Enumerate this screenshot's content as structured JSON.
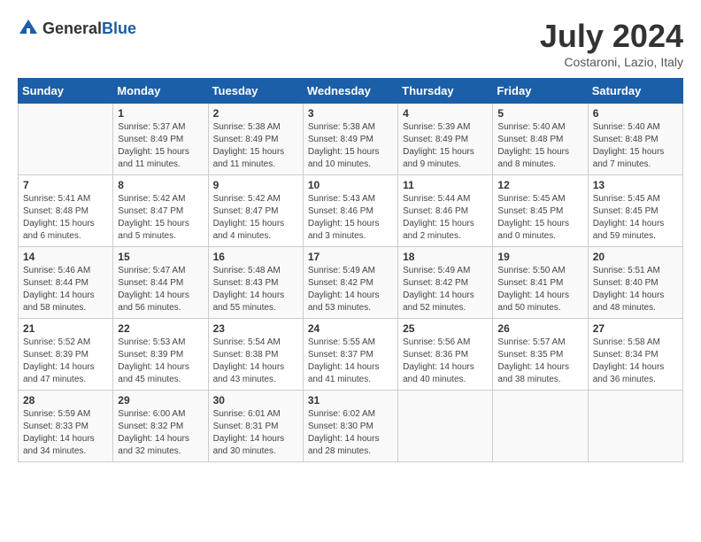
{
  "header": {
    "logo_general": "General",
    "logo_blue": "Blue",
    "month_year": "July 2024",
    "location": "Costaroni, Lazio, Italy"
  },
  "weekdays": [
    "Sunday",
    "Monday",
    "Tuesday",
    "Wednesday",
    "Thursday",
    "Friday",
    "Saturday"
  ],
  "weeks": [
    [
      {
        "day": "",
        "info": ""
      },
      {
        "day": "1",
        "info": "Sunrise: 5:37 AM\nSunset: 8:49 PM\nDaylight: 15 hours\nand 11 minutes."
      },
      {
        "day": "2",
        "info": "Sunrise: 5:38 AM\nSunset: 8:49 PM\nDaylight: 15 hours\nand 11 minutes."
      },
      {
        "day": "3",
        "info": "Sunrise: 5:38 AM\nSunset: 8:49 PM\nDaylight: 15 hours\nand 10 minutes."
      },
      {
        "day": "4",
        "info": "Sunrise: 5:39 AM\nSunset: 8:49 PM\nDaylight: 15 hours\nand 9 minutes."
      },
      {
        "day": "5",
        "info": "Sunrise: 5:40 AM\nSunset: 8:48 PM\nDaylight: 15 hours\nand 8 minutes."
      },
      {
        "day": "6",
        "info": "Sunrise: 5:40 AM\nSunset: 8:48 PM\nDaylight: 15 hours\nand 7 minutes."
      }
    ],
    [
      {
        "day": "7",
        "info": "Sunrise: 5:41 AM\nSunset: 8:48 PM\nDaylight: 15 hours\nand 6 minutes."
      },
      {
        "day": "8",
        "info": "Sunrise: 5:42 AM\nSunset: 8:47 PM\nDaylight: 15 hours\nand 5 minutes."
      },
      {
        "day": "9",
        "info": "Sunrise: 5:42 AM\nSunset: 8:47 PM\nDaylight: 15 hours\nand 4 minutes."
      },
      {
        "day": "10",
        "info": "Sunrise: 5:43 AM\nSunset: 8:46 PM\nDaylight: 15 hours\nand 3 minutes."
      },
      {
        "day": "11",
        "info": "Sunrise: 5:44 AM\nSunset: 8:46 PM\nDaylight: 15 hours\nand 2 minutes."
      },
      {
        "day": "12",
        "info": "Sunrise: 5:45 AM\nSunset: 8:45 PM\nDaylight: 15 hours\nand 0 minutes."
      },
      {
        "day": "13",
        "info": "Sunrise: 5:45 AM\nSunset: 8:45 PM\nDaylight: 14 hours\nand 59 minutes."
      }
    ],
    [
      {
        "day": "14",
        "info": "Sunrise: 5:46 AM\nSunset: 8:44 PM\nDaylight: 14 hours\nand 58 minutes."
      },
      {
        "day": "15",
        "info": "Sunrise: 5:47 AM\nSunset: 8:44 PM\nDaylight: 14 hours\nand 56 minutes."
      },
      {
        "day": "16",
        "info": "Sunrise: 5:48 AM\nSunset: 8:43 PM\nDaylight: 14 hours\nand 55 minutes."
      },
      {
        "day": "17",
        "info": "Sunrise: 5:49 AM\nSunset: 8:42 PM\nDaylight: 14 hours\nand 53 minutes."
      },
      {
        "day": "18",
        "info": "Sunrise: 5:49 AM\nSunset: 8:42 PM\nDaylight: 14 hours\nand 52 minutes."
      },
      {
        "day": "19",
        "info": "Sunrise: 5:50 AM\nSunset: 8:41 PM\nDaylight: 14 hours\nand 50 minutes."
      },
      {
        "day": "20",
        "info": "Sunrise: 5:51 AM\nSunset: 8:40 PM\nDaylight: 14 hours\nand 48 minutes."
      }
    ],
    [
      {
        "day": "21",
        "info": "Sunrise: 5:52 AM\nSunset: 8:39 PM\nDaylight: 14 hours\nand 47 minutes."
      },
      {
        "day": "22",
        "info": "Sunrise: 5:53 AM\nSunset: 8:39 PM\nDaylight: 14 hours\nand 45 minutes."
      },
      {
        "day": "23",
        "info": "Sunrise: 5:54 AM\nSunset: 8:38 PM\nDaylight: 14 hours\nand 43 minutes."
      },
      {
        "day": "24",
        "info": "Sunrise: 5:55 AM\nSunset: 8:37 PM\nDaylight: 14 hours\nand 41 minutes."
      },
      {
        "day": "25",
        "info": "Sunrise: 5:56 AM\nSunset: 8:36 PM\nDaylight: 14 hours\nand 40 minutes."
      },
      {
        "day": "26",
        "info": "Sunrise: 5:57 AM\nSunset: 8:35 PM\nDaylight: 14 hours\nand 38 minutes."
      },
      {
        "day": "27",
        "info": "Sunrise: 5:58 AM\nSunset: 8:34 PM\nDaylight: 14 hours\nand 36 minutes."
      }
    ],
    [
      {
        "day": "28",
        "info": "Sunrise: 5:59 AM\nSunset: 8:33 PM\nDaylight: 14 hours\nand 34 minutes."
      },
      {
        "day": "29",
        "info": "Sunrise: 6:00 AM\nSunset: 8:32 PM\nDaylight: 14 hours\nand 32 minutes."
      },
      {
        "day": "30",
        "info": "Sunrise: 6:01 AM\nSunset: 8:31 PM\nDaylight: 14 hours\nand 30 minutes."
      },
      {
        "day": "31",
        "info": "Sunrise: 6:02 AM\nSunset: 8:30 PM\nDaylight: 14 hours\nand 28 minutes."
      },
      {
        "day": "",
        "info": ""
      },
      {
        "day": "",
        "info": ""
      },
      {
        "day": "",
        "info": ""
      }
    ]
  ]
}
